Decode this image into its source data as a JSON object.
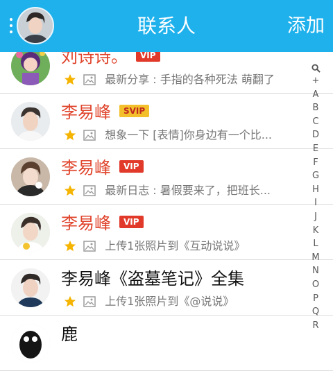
{
  "header": {
    "title": "联系人",
    "add_label": "添加",
    "menu_icon": "more-vertical-icon",
    "avatar_icon": "user-avatar"
  },
  "contacts": [
    {
      "name": "刘诗诗。",
      "badge": "VIP",
      "badge_type": "vip",
      "status": "最新分享 : 手指的各种死法 萌翻了",
      "name_color": "#e0442c"
    },
    {
      "name": "李易峰",
      "badge": "SVIP",
      "badge_type": "svip",
      "status": "想象一下 [表情]你身边有一个比...",
      "name_color": "#e0442c"
    },
    {
      "name": "李易峰",
      "badge": "VIP",
      "badge_type": "vip",
      "status": "最新日志 : 暑假要来了，把班长...",
      "name_color": "#e0442c"
    },
    {
      "name": "李易峰",
      "badge": "VIP",
      "badge_type": "vip",
      "status": "上传1张照片到《互动说说》",
      "name_color": "#e0442c"
    },
    {
      "name": "李易峰《盗墓笔记》全集",
      "badge": "",
      "badge_type": "",
      "status": "上传1张照片到《@说说》",
      "name_color": "#111111"
    },
    {
      "name": "鹿",
      "badge": "",
      "badge_type": "",
      "status": "",
      "name_color": "#111111"
    }
  ],
  "alphabet": [
    "+",
    "A",
    "B",
    "C",
    "D",
    "E",
    "F",
    "G",
    "H",
    "I",
    "J",
    "K",
    "L",
    "M",
    "N",
    "O",
    "P",
    "Q",
    "R"
  ],
  "colors": {
    "header": "#1fb1ec",
    "vip": "#e23a2a",
    "svip": "#f3c02b",
    "star": "#f5b400"
  }
}
